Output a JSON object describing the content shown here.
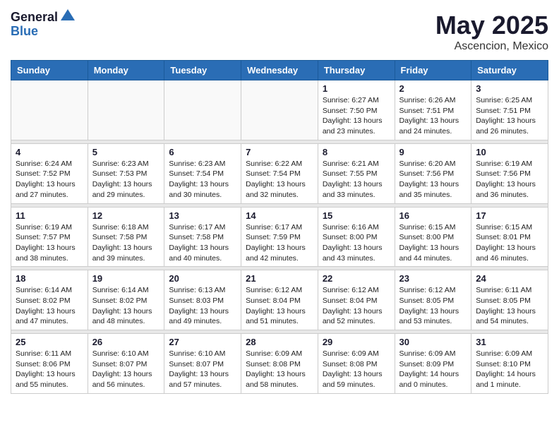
{
  "logo": {
    "general": "General",
    "blue": "Blue"
  },
  "header": {
    "month_year": "May 2025",
    "location": "Ascencion, Mexico"
  },
  "days_of_week": [
    "Sunday",
    "Monday",
    "Tuesday",
    "Wednesday",
    "Thursday",
    "Friday",
    "Saturday"
  ],
  "weeks": [
    {
      "days": [
        {
          "num": "",
          "content": ""
        },
        {
          "num": "",
          "content": ""
        },
        {
          "num": "",
          "content": ""
        },
        {
          "num": "",
          "content": ""
        },
        {
          "num": "1",
          "content": "Sunrise: 6:27 AM\nSunset: 7:50 PM\nDaylight: 13 hours\nand 23 minutes."
        },
        {
          "num": "2",
          "content": "Sunrise: 6:26 AM\nSunset: 7:51 PM\nDaylight: 13 hours\nand 24 minutes."
        },
        {
          "num": "3",
          "content": "Sunrise: 6:25 AM\nSunset: 7:51 PM\nDaylight: 13 hours\nand 26 minutes."
        }
      ]
    },
    {
      "days": [
        {
          "num": "4",
          "content": "Sunrise: 6:24 AM\nSunset: 7:52 PM\nDaylight: 13 hours\nand 27 minutes."
        },
        {
          "num": "5",
          "content": "Sunrise: 6:23 AM\nSunset: 7:53 PM\nDaylight: 13 hours\nand 29 minutes."
        },
        {
          "num": "6",
          "content": "Sunrise: 6:23 AM\nSunset: 7:54 PM\nDaylight: 13 hours\nand 30 minutes."
        },
        {
          "num": "7",
          "content": "Sunrise: 6:22 AM\nSunset: 7:54 PM\nDaylight: 13 hours\nand 32 minutes."
        },
        {
          "num": "8",
          "content": "Sunrise: 6:21 AM\nSunset: 7:55 PM\nDaylight: 13 hours\nand 33 minutes."
        },
        {
          "num": "9",
          "content": "Sunrise: 6:20 AM\nSunset: 7:56 PM\nDaylight: 13 hours\nand 35 minutes."
        },
        {
          "num": "10",
          "content": "Sunrise: 6:19 AM\nSunset: 7:56 PM\nDaylight: 13 hours\nand 36 minutes."
        }
      ]
    },
    {
      "days": [
        {
          "num": "11",
          "content": "Sunrise: 6:19 AM\nSunset: 7:57 PM\nDaylight: 13 hours\nand 38 minutes."
        },
        {
          "num": "12",
          "content": "Sunrise: 6:18 AM\nSunset: 7:58 PM\nDaylight: 13 hours\nand 39 minutes."
        },
        {
          "num": "13",
          "content": "Sunrise: 6:17 AM\nSunset: 7:58 PM\nDaylight: 13 hours\nand 40 minutes."
        },
        {
          "num": "14",
          "content": "Sunrise: 6:17 AM\nSunset: 7:59 PM\nDaylight: 13 hours\nand 42 minutes."
        },
        {
          "num": "15",
          "content": "Sunrise: 6:16 AM\nSunset: 8:00 PM\nDaylight: 13 hours\nand 43 minutes."
        },
        {
          "num": "16",
          "content": "Sunrise: 6:15 AM\nSunset: 8:00 PM\nDaylight: 13 hours\nand 44 minutes."
        },
        {
          "num": "17",
          "content": "Sunrise: 6:15 AM\nSunset: 8:01 PM\nDaylight: 13 hours\nand 46 minutes."
        }
      ]
    },
    {
      "days": [
        {
          "num": "18",
          "content": "Sunrise: 6:14 AM\nSunset: 8:02 PM\nDaylight: 13 hours\nand 47 minutes."
        },
        {
          "num": "19",
          "content": "Sunrise: 6:14 AM\nSunset: 8:02 PM\nDaylight: 13 hours\nand 48 minutes."
        },
        {
          "num": "20",
          "content": "Sunrise: 6:13 AM\nSunset: 8:03 PM\nDaylight: 13 hours\nand 49 minutes."
        },
        {
          "num": "21",
          "content": "Sunrise: 6:12 AM\nSunset: 8:04 PM\nDaylight: 13 hours\nand 51 minutes."
        },
        {
          "num": "22",
          "content": "Sunrise: 6:12 AM\nSunset: 8:04 PM\nDaylight: 13 hours\nand 52 minutes."
        },
        {
          "num": "23",
          "content": "Sunrise: 6:12 AM\nSunset: 8:05 PM\nDaylight: 13 hours\nand 53 minutes."
        },
        {
          "num": "24",
          "content": "Sunrise: 6:11 AM\nSunset: 8:05 PM\nDaylight: 13 hours\nand 54 minutes."
        }
      ]
    },
    {
      "days": [
        {
          "num": "25",
          "content": "Sunrise: 6:11 AM\nSunset: 8:06 PM\nDaylight: 13 hours\nand 55 minutes."
        },
        {
          "num": "26",
          "content": "Sunrise: 6:10 AM\nSunset: 8:07 PM\nDaylight: 13 hours\nand 56 minutes."
        },
        {
          "num": "27",
          "content": "Sunrise: 6:10 AM\nSunset: 8:07 PM\nDaylight: 13 hours\nand 57 minutes."
        },
        {
          "num": "28",
          "content": "Sunrise: 6:09 AM\nSunset: 8:08 PM\nDaylight: 13 hours\nand 58 minutes."
        },
        {
          "num": "29",
          "content": "Sunrise: 6:09 AM\nSunset: 8:08 PM\nDaylight: 13 hours\nand 59 minutes."
        },
        {
          "num": "30",
          "content": "Sunrise: 6:09 AM\nSunset: 8:09 PM\nDaylight: 14 hours\nand 0 minutes."
        },
        {
          "num": "31",
          "content": "Sunrise: 6:09 AM\nSunset: 8:10 PM\nDaylight: 14 hours\nand 1 minute."
        }
      ]
    }
  ]
}
